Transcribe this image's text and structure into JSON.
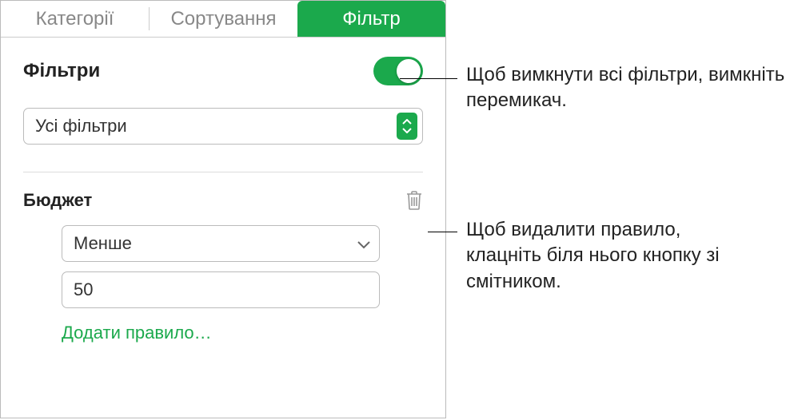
{
  "tabs": {
    "categories": "Категорії",
    "sort": "Сортування",
    "filter": "Фільтр"
  },
  "filters": {
    "title": "Фільтри",
    "scope_selected": "Усі фільтри"
  },
  "rule": {
    "column": "Бюджет",
    "operator": "Менше",
    "value": "50",
    "add_rule": "Додати правило…"
  },
  "callouts": {
    "toggle": "Щоб вимкнути всі фільтри, вимкніть перемикач.",
    "trash": "Щоб видалити правило, клацніть біля нього кнопку зі смітником."
  }
}
